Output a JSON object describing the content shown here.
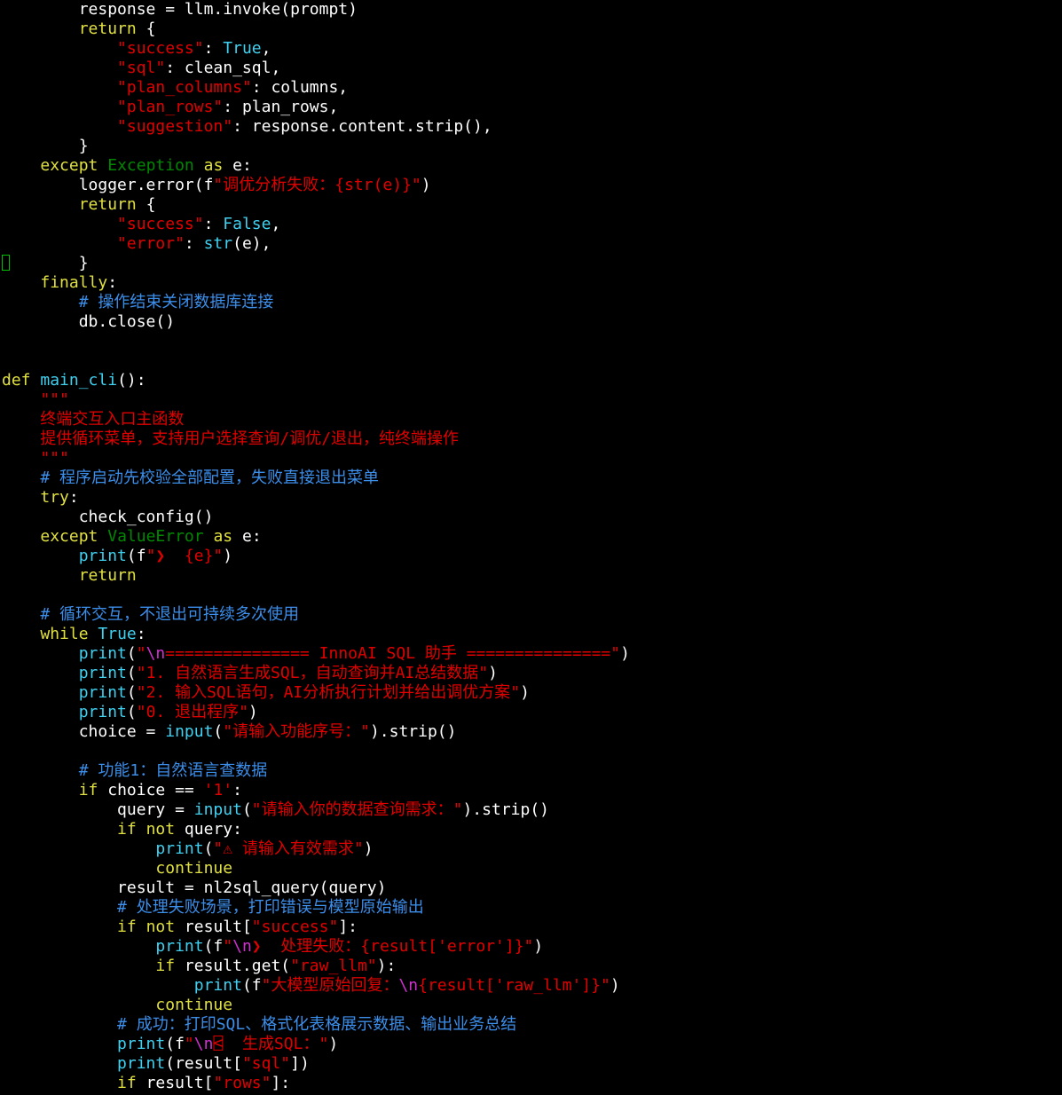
{
  "colors": {
    "background": "#000000",
    "default": "#ffffff",
    "keyword": "#e0e040",
    "string": "#e00000",
    "builtin": "#40d0f0",
    "constant": "#40d0f0",
    "exception_class": "#008800",
    "comment": "#3b8eea",
    "escape": "#d030d0",
    "cursor": "#00c000"
  },
  "editor": {
    "lines": [
      [
        {
          "t": "        response = llm.invoke(prompt)",
          "c": "default"
        }
      ],
      [
        {
          "t": "        ",
          "c": "default"
        },
        {
          "t": "return",
          "c": "keyword"
        },
        {
          "t": " {",
          "c": "default"
        }
      ],
      [
        {
          "t": "            ",
          "c": "default"
        },
        {
          "t": "\"success\"",
          "c": "string"
        },
        {
          "t": ": ",
          "c": "default"
        },
        {
          "t": "True",
          "c": "constant"
        },
        {
          "t": ",",
          "c": "default"
        }
      ],
      [
        {
          "t": "            ",
          "c": "default"
        },
        {
          "t": "\"sql\"",
          "c": "string"
        },
        {
          "t": ": clean_sql,",
          "c": "default"
        }
      ],
      [
        {
          "t": "            ",
          "c": "default"
        },
        {
          "t": "\"plan_columns\"",
          "c": "string"
        },
        {
          "t": ": columns,",
          "c": "default"
        }
      ],
      [
        {
          "t": "            ",
          "c": "default"
        },
        {
          "t": "\"plan_rows\"",
          "c": "string"
        },
        {
          "t": ": plan_rows,",
          "c": "default"
        }
      ],
      [
        {
          "t": "            ",
          "c": "default"
        },
        {
          "t": "\"suggestion\"",
          "c": "string"
        },
        {
          "t": ": response.content.strip(),",
          "c": "default"
        }
      ],
      [
        {
          "t": "        }",
          "c": "default"
        }
      ],
      [
        {
          "t": "    ",
          "c": "default"
        },
        {
          "t": "except",
          "c": "keyword"
        },
        {
          "t": " ",
          "c": "default"
        },
        {
          "t": "Exception",
          "c": "exception_class"
        },
        {
          "t": " ",
          "c": "default"
        },
        {
          "t": "as",
          "c": "keyword"
        },
        {
          "t": " e:",
          "c": "default"
        }
      ],
      [
        {
          "t": "        logger.error(f",
          "c": "default"
        },
        {
          "t": "\"调优分析失败：{str(e)}\"",
          "c": "string"
        },
        {
          "t": ")",
          "c": "default"
        }
      ],
      [
        {
          "t": "        ",
          "c": "default"
        },
        {
          "t": "return",
          "c": "keyword"
        },
        {
          "t": " {",
          "c": "default"
        }
      ],
      [
        {
          "t": "            ",
          "c": "default"
        },
        {
          "t": "\"success\"",
          "c": "string"
        },
        {
          "t": ": ",
          "c": "default"
        },
        {
          "t": "False",
          "c": "constant"
        },
        {
          "t": ",",
          "c": "default"
        }
      ],
      [
        {
          "t": "            ",
          "c": "default"
        },
        {
          "t": "\"error\"",
          "c": "string"
        },
        {
          "t": ": ",
          "c": "default"
        },
        {
          "t": "str",
          "c": "builtin"
        },
        {
          "t": "(e),",
          "c": "default"
        }
      ],
      [
        {
          "t": "        }",
          "c": "default"
        }
      ],
      [
        {
          "t": "    ",
          "c": "default"
        },
        {
          "t": "finally",
          "c": "keyword"
        },
        {
          "t": ":",
          "c": "default"
        }
      ],
      [
        {
          "t": "        ",
          "c": "default"
        },
        {
          "t": "# 操作结束关闭数据库连接",
          "c": "comment"
        }
      ],
      [
        {
          "t": "        db.close()",
          "c": "default"
        }
      ],
      [],
      [],
      [
        {
          "t": "def",
          "c": "keyword"
        },
        {
          "t": " ",
          "c": "default"
        },
        {
          "t": "main_cli",
          "c": "builtin"
        },
        {
          "t": "():",
          "c": "default"
        }
      ],
      [
        {
          "t": "    ",
          "c": "default"
        },
        {
          "t": "\"\"\"",
          "c": "string"
        }
      ],
      [
        {
          "t": "    ",
          "c": "default"
        },
        {
          "t": "终端交互入口主函数",
          "c": "string"
        }
      ],
      [
        {
          "t": "    ",
          "c": "default"
        },
        {
          "t": "提供循环菜单，支持用户选择查询/调优/退出，纯终端操作",
          "c": "string"
        }
      ],
      [
        {
          "t": "    ",
          "c": "default"
        },
        {
          "t": "\"\"\"",
          "c": "string"
        }
      ],
      [
        {
          "t": "    ",
          "c": "default"
        },
        {
          "t": "# 程序启动先校验全部配置，失败直接退出菜单",
          "c": "comment"
        }
      ],
      [
        {
          "t": "    ",
          "c": "default"
        },
        {
          "t": "try",
          "c": "keyword"
        },
        {
          "t": ":",
          "c": "default"
        }
      ],
      [
        {
          "t": "        check_config()",
          "c": "default"
        }
      ],
      [
        {
          "t": "    ",
          "c": "default"
        },
        {
          "t": "except",
          "c": "keyword"
        },
        {
          "t": " ",
          "c": "default"
        },
        {
          "t": "ValueError",
          "c": "exception_class"
        },
        {
          "t": " ",
          "c": "default"
        },
        {
          "t": "as",
          "c": "keyword"
        },
        {
          "t": " e:",
          "c": "default"
        }
      ],
      [
        {
          "t": "        ",
          "c": "default"
        },
        {
          "t": "print",
          "c": "builtin"
        },
        {
          "t": "(f",
          "c": "default"
        },
        {
          "t": "\"❯  {e}\"",
          "c": "string"
        },
        {
          "t": ")",
          "c": "default"
        }
      ],
      [
        {
          "t": "        ",
          "c": "default"
        },
        {
          "t": "return",
          "c": "keyword"
        }
      ],
      [],
      [
        {
          "t": "    ",
          "c": "default"
        },
        {
          "t": "# 循环交互，不退出可持续多次使用",
          "c": "comment"
        }
      ],
      [
        {
          "t": "    ",
          "c": "default"
        },
        {
          "t": "while",
          "c": "keyword"
        },
        {
          "t": " ",
          "c": "default"
        },
        {
          "t": "True",
          "c": "constant"
        },
        {
          "t": ":",
          "c": "default"
        }
      ],
      [
        {
          "t": "        ",
          "c": "default"
        },
        {
          "t": "print",
          "c": "builtin"
        },
        {
          "t": "(",
          "c": "default"
        },
        {
          "t": "\"",
          "c": "string"
        },
        {
          "t": "\\n",
          "c": "escape"
        },
        {
          "t": "=============== InnoAI SQL 助手 ===============\"",
          "c": "string"
        },
        {
          "t": ")",
          "c": "default"
        }
      ],
      [
        {
          "t": "        ",
          "c": "default"
        },
        {
          "t": "print",
          "c": "builtin"
        },
        {
          "t": "(",
          "c": "default"
        },
        {
          "t": "\"1. 自然语言生成SQL，自动查询并AI总结数据\"",
          "c": "string"
        },
        {
          "t": ")",
          "c": "default"
        }
      ],
      [
        {
          "t": "        ",
          "c": "default"
        },
        {
          "t": "print",
          "c": "builtin"
        },
        {
          "t": "(",
          "c": "default"
        },
        {
          "t": "\"2. 输入SQL语句，AI分析执行计划并给出调优方案\"",
          "c": "string"
        },
        {
          "t": ")",
          "c": "default"
        }
      ],
      [
        {
          "t": "        ",
          "c": "default"
        },
        {
          "t": "print",
          "c": "builtin"
        },
        {
          "t": "(",
          "c": "default"
        },
        {
          "t": "\"0. 退出程序\"",
          "c": "string"
        },
        {
          "t": ")",
          "c": "default"
        }
      ],
      [
        {
          "t": "        choice = ",
          "c": "default"
        },
        {
          "t": "input",
          "c": "builtin"
        },
        {
          "t": "(",
          "c": "default"
        },
        {
          "t": "\"请输入功能序号：\"",
          "c": "string"
        },
        {
          "t": ").strip()",
          "c": "default"
        }
      ],
      [],
      [
        {
          "t": "        ",
          "c": "default"
        },
        {
          "t": "# 功能1：自然语言查数据",
          "c": "comment"
        }
      ],
      [
        {
          "t": "        ",
          "c": "default"
        },
        {
          "t": "if",
          "c": "keyword"
        },
        {
          "t": " choice == ",
          "c": "default"
        },
        {
          "t": "'1'",
          "c": "string"
        },
        {
          "t": ":",
          "c": "default"
        }
      ],
      [
        {
          "t": "            query = ",
          "c": "default"
        },
        {
          "t": "input",
          "c": "builtin"
        },
        {
          "t": "(",
          "c": "default"
        },
        {
          "t": "\"请输入你的数据查询需求：\"",
          "c": "string"
        },
        {
          "t": ").strip()",
          "c": "default"
        }
      ],
      [
        {
          "t": "            ",
          "c": "default"
        },
        {
          "t": "if",
          "c": "keyword"
        },
        {
          "t": " ",
          "c": "default"
        },
        {
          "t": "not",
          "c": "keyword"
        },
        {
          "t": " query:",
          "c": "default"
        }
      ],
      [
        {
          "t": "                ",
          "c": "default"
        },
        {
          "t": "print",
          "c": "builtin"
        },
        {
          "t": "(",
          "c": "default"
        },
        {
          "t": "\"⚠ 请输入有效需求\"",
          "c": "string"
        },
        {
          "t": ")",
          "c": "default"
        }
      ],
      [
        {
          "t": "                ",
          "c": "default"
        },
        {
          "t": "continue",
          "c": "keyword"
        }
      ],
      [
        {
          "t": "            result = nl2sql_query(query)",
          "c": "default"
        }
      ],
      [
        {
          "t": "            ",
          "c": "default"
        },
        {
          "t": "# 处理失败场景，打印错误与模型原始输出",
          "c": "comment"
        }
      ],
      [
        {
          "t": "            ",
          "c": "default"
        },
        {
          "t": "if",
          "c": "keyword"
        },
        {
          "t": " ",
          "c": "default"
        },
        {
          "t": "not",
          "c": "keyword"
        },
        {
          "t": " result[",
          "c": "default"
        },
        {
          "t": "\"success\"",
          "c": "string"
        },
        {
          "t": "]:",
          "c": "default"
        }
      ],
      [
        {
          "t": "                ",
          "c": "default"
        },
        {
          "t": "print",
          "c": "builtin"
        },
        {
          "t": "(f",
          "c": "default"
        },
        {
          "t": "\"",
          "c": "string"
        },
        {
          "t": "\\n",
          "c": "escape"
        },
        {
          "t": "❯  处理失败：{result['error']}\"",
          "c": "string"
        },
        {
          "t": ")",
          "c": "default"
        }
      ],
      [
        {
          "t": "                ",
          "c": "default"
        },
        {
          "t": "if",
          "c": "keyword"
        },
        {
          "t": " result.get(",
          "c": "default"
        },
        {
          "t": "\"raw_llm\"",
          "c": "string"
        },
        {
          "t": "):",
          "c": "default"
        }
      ],
      [
        {
          "t": "                    ",
          "c": "default"
        },
        {
          "t": "print",
          "c": "builtin"
        },
        {
          "t": "(f",
          "c": "default"
        },
        {
          "t": "\"大模型原始回复：",
          "c": "string"
        },
        {
          "t": "\\n",
          "c": "escape"
        },
        {
          "t": "{result['raw_llm']}\"",
          "c": "string"
        },
        {
          "t": ")",
          "c": "default"
        }
      ],
      [
        {
          "t": "                ",
          "c": "default"
        },
        {
          "t": "continue",
          "c": "keyword"
        }
      ],
      [
        {
          "t": "            ",
          "c": "default"
        },
        {
          "t": "# 成功：打印SQL、格式化表格展示数据、输出业务总结",
          "c": "comment"
        }
      ],
      [
        {
          "t": "            ",
          "c": "default"
        },
        {
          "t": "print",
          "c": "builtin"
        },
        {
          "t": "(f",
          "c": "default"
        },
        {
          "t": "\"",
          "c": "string"
        },
        {
          "t": "\\n",
          "c": "escape"
        },
        {
          "t": "⍃  生成SQL：\"",
          "c": "string"
        },
        {
          "t": ")",
          "c": "default"
        }
      ],
      [
        {
          "t": "            ",
          "c": "default"
        },
        {
          "t": "print",
          "c": "builtin"
        },
        {
          "t": "(result[",
          "c": "default"
        },
        {
          "t": "\"sql\"",
          "c": "string"
        },
        {
          "t": "])",
          "c": "default"
        }
      ],
      [
        {
          "t": "            ",
          "c": "default"
        },
        {
          "t": "if",
          "c": "keyword"
        },
        {
          "t": " result[",
          "c": "default"
        },
        {
          "t": "\"rows\"",
          "c": "string"
        },
        {
          "t": "]:",
          "c": "default"
        }
      ]
    ]
  }
}
